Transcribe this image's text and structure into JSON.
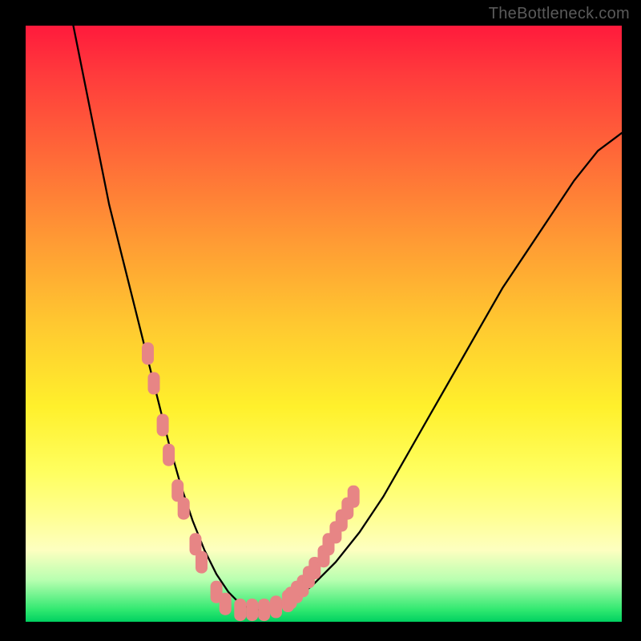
{
  "watermark": {
    "text": "TheBottleneck.com"
  },
  "chart_data": {
    "type": "line",
    "title": "",
    "xlabel": "",
    "ylabel": "",
    "xlim": [
      0,
      100
    ],
    "ylim": [
      0,
      100
    ],
    "series": [
      {
        "name": "bottleneck-curve",
        "x": [
          8,
          10,
          12,
          14,
          16,
          18,
          20,
          22,
          24,
          26,
          28,
          30,
          32,
          34,
          36,
          38,
          40,
          44,
          48,
          52,
          56,
          60,
          64,
          68,
          72,
          76,
          80,
          84,
          88,
          92,
          96,
          100
        ],
        "y": [
          100,
          90,
          80,
          70,
          62,
          54,
          46,
          38,
          30,
          23,
          17,
          12,
          8,
          5,
          3,
          2,
          2,
          3,
          6,
          10,
          15,
          21,
          28,
          35,
          42,
          49,
          56,
          62,
          68,
          74,
          79,
          82
        ]
      }
    ],
    "markers": {
      "name": "highlight-dots",
      "color": "#e78585",
      "points": [
        {
          "x": 20.5,
          "y": 45
        },
        {
          "x": 21.5,
          "y": 40
        },
        {
          "x": 23.0,
          "y": 33
        },
        {
          "x": 24.0,
          "y": 28
        },
        {
          "x": 25.5,
          "y": 22
        },
        {
          "x": 26.5,
          "y": 19
        },
        {
          "x": 28.5,
          "y": 13
        },
        {
          "x": 29.5,
          "y": 10
        },
        {
          "x": 32.0,
          "y": 5
        },
        {
          "x": 33.5,
          "y": 3
        },
        {
          "x": 36.0,
          "y": 2
        },
        {
          "x": 38.0,
          "y": 2
        },
        {
          "x": 40.0,
          "y": 2
        },
        {
          "x": 42.0,
          "y": 2.5
        },
        {
          "x": 44.0,
          "y": 3.5
        },
        {
          "x": 44.5,
          "y": 4
        },
        {
          "x": 45.5,
          "y": 5
        },
        {
          "x": 46.5,
          "y": 6
        },
        {
          "x": 47.5,
          "y": 7.5
        },
        {
          "x": 48.5,
          "y": 9
        },
        {
          "x": 50.0,
          "y": 11
        },
        {
          "x": 50.8,
          "y": 13
        },
        {
          "x": 52.0,
          "y": 15
        },
        {
          "x": 53.0,
          "y": 17
        },
        {
          "x": 54.0,
          "y": 19
        },
        {
          "x": 55.0,
          "y": 21
        }
      ]
    }
  }
}
